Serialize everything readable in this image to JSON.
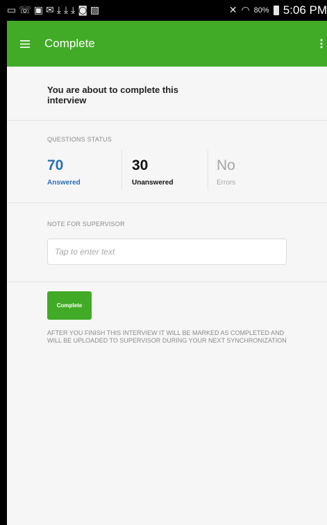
{
  "status_bar": {
    "icons": [
      "cast-icon",
      "wifi-call-icon",
      "screen-icon",
      "mail-icon",
      "download-icon",
      "download-icon",
      "download-icon",
      "camera-icon",
      "photo-icon"
    ],
    "battery_percent": "80%",
    "time": "5:06 PM"
  },
  "app_bar": {
    "title": "Complete",
    "color": "#41ab27"
  },
  "intro": {
    "text": "You are about to complete this interview"
  },
  "questions_status": {
    "label": "QUESTIONS STATUS",
    "answered": {
      "value": "70",
      "caption": "Answered"
    },
    "unanswered": {
      "value": "30",
      "caption": "Unanswered"
    },
    "errors": {
      "value": "No",
      "caption": "Errors"
    }
  },
  "note": {
    "label": "NOTE FOR SUPERVISOR",
    "placeholder": "Tap to enter text"
  },
  "complete_button": {
    "label": "Complete"
  },
  "finish_note": "AFTER YOU FINISH THIS INTERVIEW IT WILL BE MARKED AS COMPLETED AND WILL BE UPLOADED TO SUPERVISOR DURING YOUR NEXT SYNCHRONIZATION"
}
